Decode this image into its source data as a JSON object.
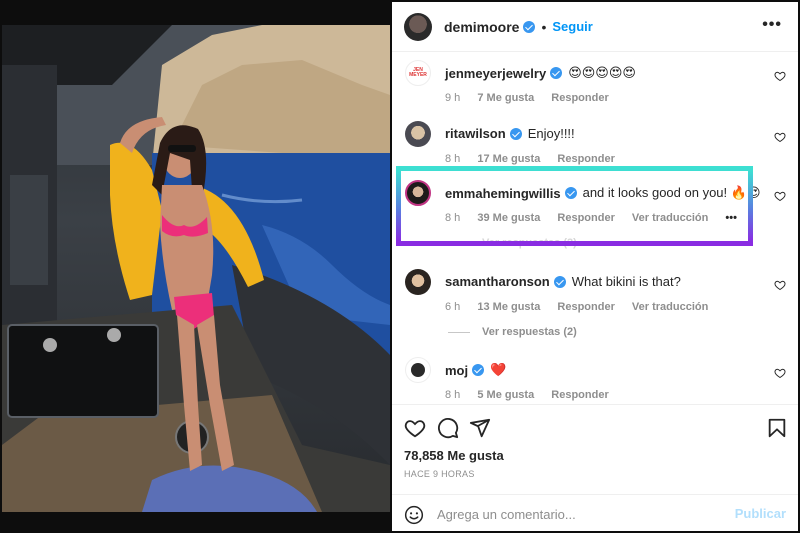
{
  "post": {
    "username": "demimoore",
    "follow_label": "Seguir",
    "separator": "•",
    "more_label": "•••"
  },
  "comments": [
    {
      "user": "jenmeyerjewelry",
      "text": "😍😍😍😍😍",
      "time": "9 h",
      "likes": "7 Me gusta",
      "reply": "Responder",
      "translate": ""
    },
    {
      "user": "ritawilson",
      "text": "Enjoy!!!!",
      "time": "8 h",
      "likes": "17 Me gusta",
      "reply": "Responder",
      "translate": ""
    },
    {
      "user": "emmahemingwillis",
      "text": "and it looks good on you! 🔥😍",
      "time": "8 h",
      "likes": "39 Me gusta",
      "reply": "Responder",
      "translate": "Ver traducción",
      "more": "•••",
      "replies": "Ver respuestas (2)"
    },
    {
      "user": "samantharonson",
      "text": "What bikini is that?",
      "time": "6 h",
      "likes": "13 Me gusta",
      "reply": "Responder",
      "translate": "Ver traducción",
      "replies": "Ver respuestas (2)"
    },
    {
      "user": "moj",
      "text": "❤️",
      "time": "8 h",
      "likes": "5 Me gusta",
      "reply": "Responder",
      "translate": ""
    }
  ],
  "footer": {
    "likes_count": "78,858 Me gusta",
    "time_ago": "HACE 9 HORAS",
    "comment_placeholder": "Agrega un comentario...",
    "post_label": "Publicar"
  },
  "icons": {
    "verified": "verified-badge-icon",
    "heart": "heart-icon",
    "comment": "comment-icon",
    "share": "share-icon",
    "save": "bookmark-icon",
    "emoji": "emoji-icon"
  },
  "colors": {
    "link_blue": "#0095f6",
    "verified_blue": "#3897f0",
    "highlight_top": "#3de0d2",
    "highlight_bottom": "#8a2be2",
    "muted": "#8e8e8e"
  }
}
